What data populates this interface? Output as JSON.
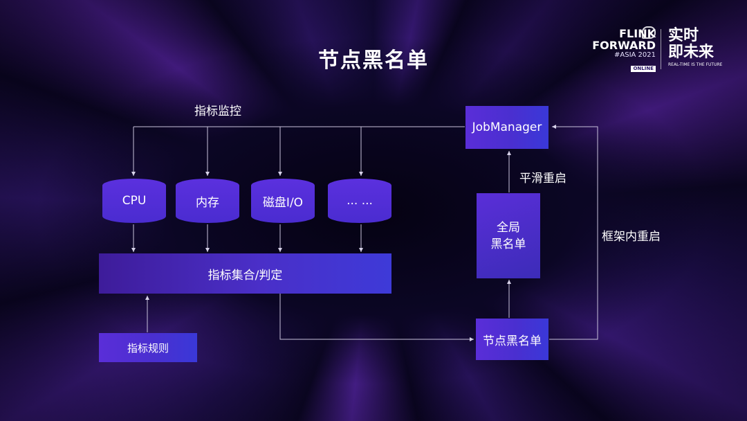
{
  "logo": {
    "line1": "FLINK",
    "line2": "FORWARD",
    "event": "#ASIA 2021",
    "badge": "ONLINE",
    "cn_line1": "实时",
    "cn_line2": "即未来",
    "tagline": "REAL-TIME IS THE FUTURE"
  },
  "title": "节点黑名单",
  "labels": {
    "metrics_monitor": "指标监控",
    "smooth_restart": "平滑重启",
    "framework_restart": "框架内重启"
  },
  "cylinders": [
    "CPU",
    "内存",
    "磁盘I/O",
    "... ..."
  ],
  "boxes": {
    "aggregate": "指标集合/判定",
    "rules": "指标规则",
    "jobmanager": "JobManager",
    "global_blacklist": "全局\n黑名单",
    "node_blacklist": "节点黑名单"
  },
  "colors": {
    "box_primary": "#4a2fd0",
    "line": "#c9c3dc"
  }
}
